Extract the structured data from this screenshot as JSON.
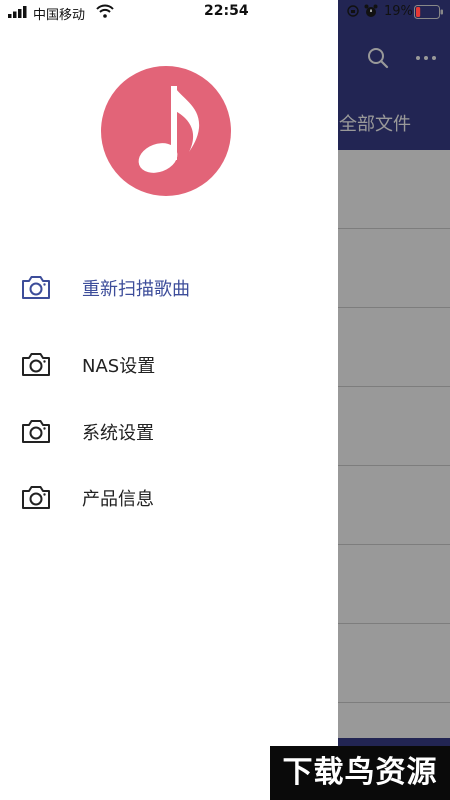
{
  "status_bar": {
    "carrier": "中国移动",
    "time": "22:54",
    "battery_percent": "19%",
    "battery_level": 0.19,
    "icons": [
      "signal-icon",
      "wifi-icon",
      "rotation-lock-icon",
      "alarm-icon",
      "battery-icon"
    ]
  },
  "background_app": {
    "tab_label": "全部文件",
    "header_color": "#3a3f8a",
    "icons": [
      "search-icon",
      "more-icon"
    ]
  },
  "drawer": {
    "logo_icon": "music-note-icon",
    "logo_color": "#e26478",
    "active_color": "#3d4d9a",
    "items": [
      {
        "label": "重新扫描歌曲",
        "icon": "camera-icon",
        "active": true
      },
      {
        "label": "NAS设置",
        "icon": "camera-icon",
        "active": false
      },
      {
        "label": "系统设置",
        "icon": "camera-icon",
        "active": false
      },
      {
        "label": "产品信息",
        "icon": "camera-icon",
        "active": false
      }
    ]
  },
  "watermark": {
    "text": "下载鸟资源"
  }
}
